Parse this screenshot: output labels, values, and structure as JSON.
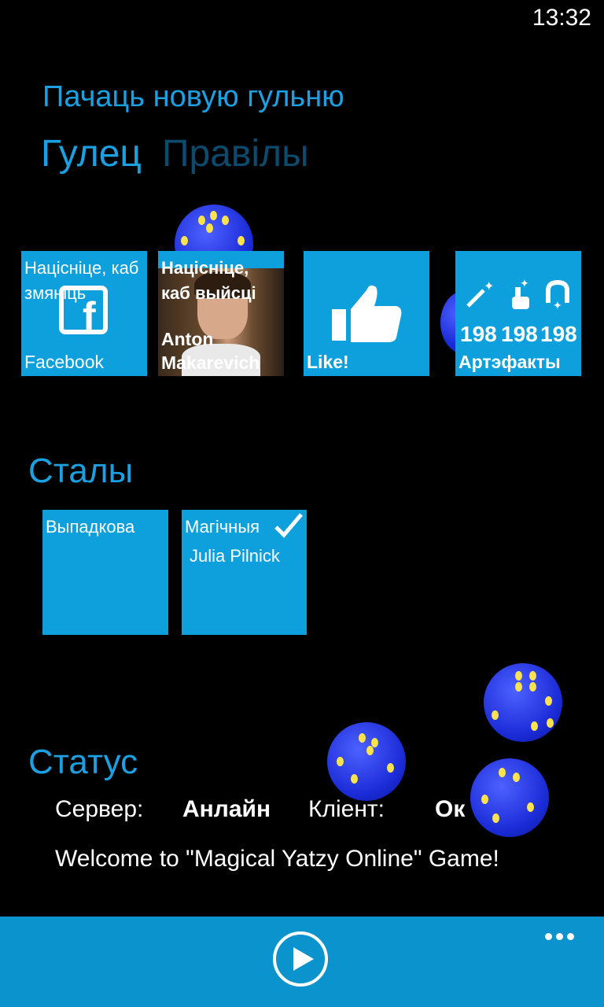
{
  "status_bar": {
    "time": "13:32"
  },
  "header": {
    "title": "Пачаць новую гульню",
    "pivots": [
      "Гулец",
      "Правілы"
    ]
  },
  "player_tiles": [
    {
      "top": "Націсніце, каб змяніць",
      "label": "Facebook",
      "icon": "facebook-icon"
    },
    {
      "top": "Націсніце, каб выйсці",
      "label": "Anton Makarevich",
      "icon": "avatar"
    },
    {
      "label": "Like!",
      "icon": "thumbs-up-icon"
    },
    {
      "label": "Артэфакты",
      "counts": [
        "198",
        "198",
        "198"
      ],
      "icons": [
        "magic-wand-icon",
        "tap-icon",
        "magnet-icon"
      ]
    }
  ],
  "tables": {
    "title": "Сталы",
    "items": [
      {
        "label": "Выпадкова"
      },
      {
        "label": "Магічныя",
        "player": "Julia Pilnick",
        "checked": true
      }
    ]
  },
  "status": {
    "title": "Статус",
    "server_label": "Сервер:",
    "server_value": "Анлайн",
    "client_label": "Кліент:",
    "client_value": "Ок",
    "message": "Welcome to \"Magical Yatzy Online\" Game!"
  },
  "appbar": {
    "play_icon": "play-icon",
    "more_icon": "more-icon"
  },
  "colors": {
    "accent": "#1ba1e2",
    "tile": "#0ea0dc",
    "appbar": "#0a93cc",
    "die": "#1a2bd6",
    "pip": "#ffe34d"
  }
}
